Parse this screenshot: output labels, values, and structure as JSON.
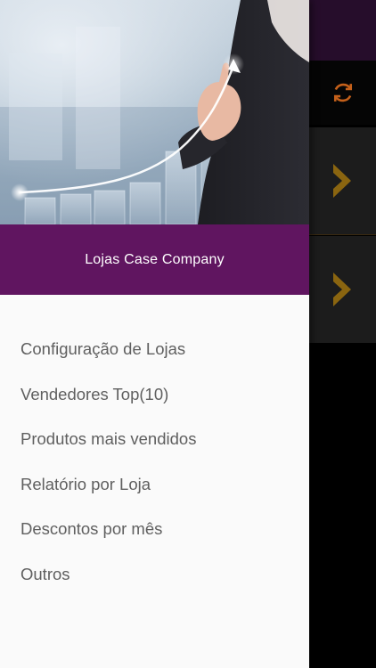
{
  "drawer": {
    "header": {
      "title": "Lojas Case Company"
    },
    "hero": {
      "image": "businesswoman-rising-chart-photo"
    },
    "menu_items": [
      {
        "label": "Configuração de Lojas"
      },
      {
        "label": "Vendedores Top(10)"
      },
      {
        "label": "Produtos mais vendidos"
      },
      {
        "label": "Relatório por Loja"
      },
      {
        "label": "Descontos por mês"
      },
      {
        "label": "Outros"
      }
    ]
  },
  "background": {
    "icons": [
      "refresh-icon",
      "chevron-right-icon",
      "chevron-right-icon"
    ],
    "colors": {
      "accent": "#c4601a",
      "chevron": "#8a6510",
      "header": "#601560"
    }
  }
}
